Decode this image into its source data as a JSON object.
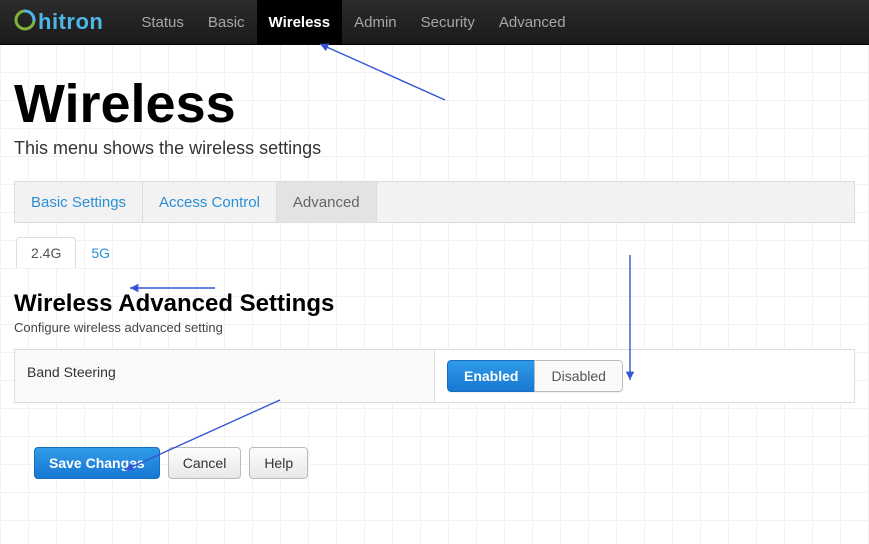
{
  "brand": "hitron",
  "nav": {
    "items": [
      {
        "label": "Status",
        "active": false
      },
      {
        "label": "Basic",
        "active": false
      },
      {
        "label": "Wireless",
        "active": true
      },
      {
        "label": "Admin",
        "active": false
      },
      {
        "label": "Security",
        "active": false
      },
      {
        "label": "Advanced",
        "active": false
      }
    ]
  },
  "page": {
    "title": "Wireless",
    "subtitle": "This menu shows the wireless settings"
  },
  "subtabs": [
    {
      "label": "Basic Settings",
      "active": false
    },
    {
      "label": "Access Control",
      "active": false
    },
    {
      "label": "Advanced",
      "active": true
    }
  ],
  "bandtabs": [
    {
      "label": "2.4G",
      "active": true
    },
    {
      "label": "5G",
      "active": false
    }
  ],
  "section": {
    "title": "Wireless Advanced Settings",
    "subtitle": "Configure wireless advanced setting"
  },
  "settings": {
    "band_steering": {
      "label": "Band Steering",
      "enabled_label": "Enabled",
      "disabled_label": "Disabled",
      "value": "enabled"
    }
  },
  "actions": {
    "save": "Save Changes",
    "cancel": "Cancel",
    "help": "Help"
  },
  "colors": {
    "accent_blue": "#1f7fcf",
    "link_blue": "#2b8fd6",
    "nav_bg": "#1e1e1e"
  }
}
